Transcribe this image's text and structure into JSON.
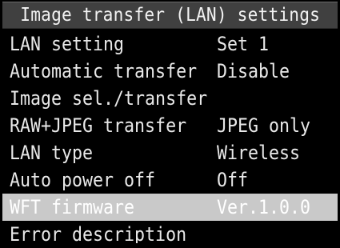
{
  "title": "Image transfer (LAN) settings",
  "menu": [
    {
      "label": "LAN setting",
      "value": "Set 1"
    },
    {
      "label": "Automatic transfer",
      "value": "Disable"
    },
    {
      "label": "Image sel./transfer",
      "value": ""
    },
    {
      "label": "RAW+JPEG transfer",
      "value": "JPEG only"
    },
    {
      "label": "LAN type",
      "value": "Wireless"
    },
    {
      "label": "Auto power off",
      "value": "Off"
    },
    {
      "label": "WFT firmware",
      "value": "Ver.1.0.0",
      "selected": true
    },
    {
      "label": "Error description",
      "value": ""
    }
  ],
  "colors": {
    "background": "#000000",
    "title_bar": "#404040",
    "selection": "#c9c9c9",
    "text": "#e8e8e8"
  }
}
